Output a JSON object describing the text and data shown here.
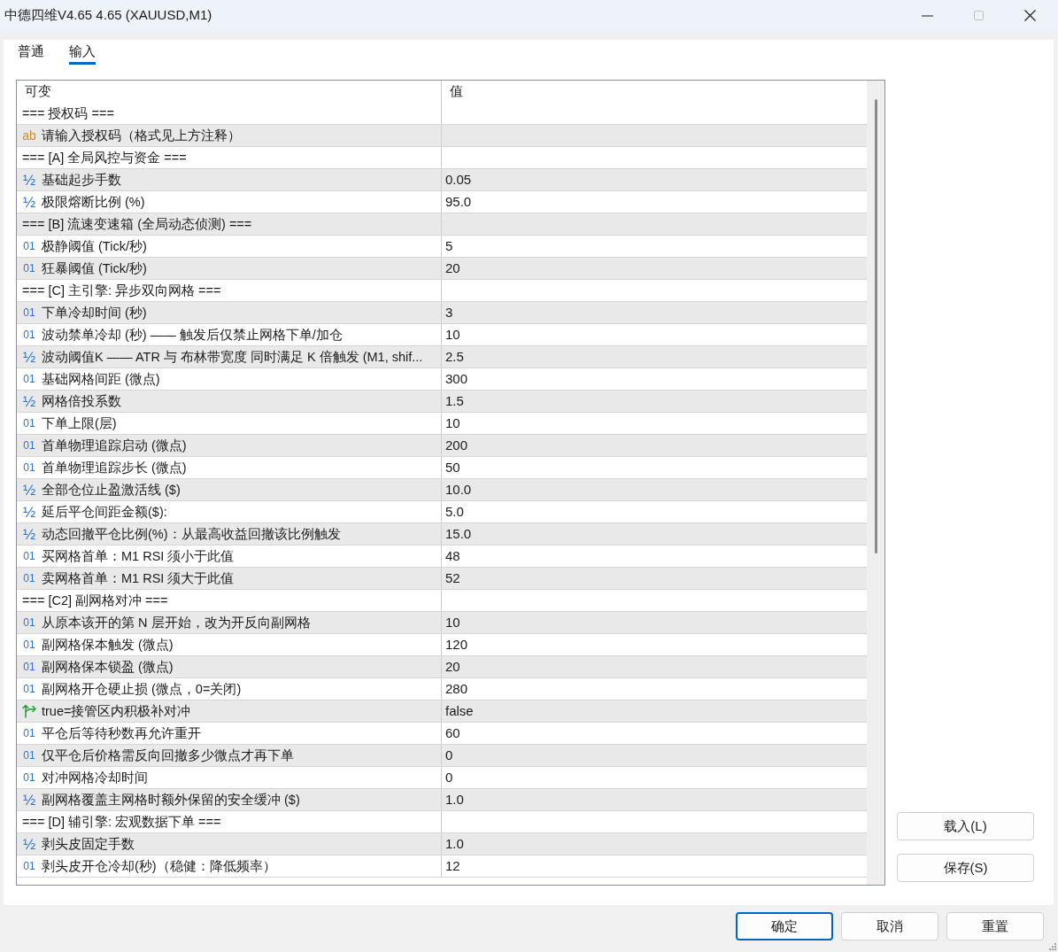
{
  "window": {
    "title": "中德四维V4.65 4.65 (XAUUSD,M1)",
    "controls": [
      {
        "kind": "minimize",
        "disabled": false
      },
      {
        "kind": "maximize",
        "disabled": true
      },
      {
        "kind": "close",
        "disabled": false
      }
    ]
  },
  "tabs": [
    {
      "label": "普通",
      "selected": false
    },
    {
      "label": "输入",
      "selected": true
    }
  ],
  "table": {
    "columns": [
      "可变",
      "值"
    ],
    "rows": [
      {
        "kind": "section",
        "name": "=== 授权码 ==="
      },
      {
        "kind": "string",
        "icon": "ab",
        "name": "请输入授权码（格式见上方注释）"
      },
      {
        "kind": "section",
        "name": "=== [A] 全局风控与资金 ==="
      },
      {
        "kind": "double",
        "icon": "½",
        "name": "基础起步手数",
        "value": "0.05"
      },
      {
        "kind": "double",
        "icon": "½",
        "name": "极限熔断比例 (%)",
        "value": "95.0"
      },
      {
        "kind": "section",
        "name": "=== [B] 流速变速箱 (全局动态侦测) ==="
      },
      {
        "kind": "int",
        "icon": "01",
        "name": "极静阈值 (Tick/秒)",
        "value": "5"
      },
      {
        "kind": "int",
        "icon": "01",
        "name": "狂暴阈值 (Tick/秒)",
        "value": "20"
      },
      {
        "kind": "section",
        "name": "=== [C] 主引擎: 异步双向网格 ==="
      },
      {
        "kind": "int",
        "icon": "01",
        "name": "下单冷却时间 (秒)",
        "value": "3"
      },
      {
        "kind": "int",
        "icon": "01",
        "name": "波动禁单冷却 (秒) —— 触发后仅禁止网格下单/加仓",
        "value": "10"
      },
      {
        "kind": "double",
        "icon": "½",
        "name": "波动阈值K —— ATR 与 布林带宽度 同时满足 K 倍触发 (M1, shif...",
        "value": "2.5"
      },
      {
        "kind": "int",
        "icon": "01",
        "name": "基础网格间距 (微点)",
        "value": "300"
      },
      {
        "kind": "double",
        "icon": "½",
        "name": "网格倍投系数",
        "value": "1.5"
      },
      {
        "kind": "int",
        "icon": "01",
        "name": "下单上限(层)",
        "value": "10"
      },
      {
        "kind": "int",
        "icon": "01",
        "name": "首单物理追踪启动 (微点)",
        "value": "200"
      },
      {
        "kind": "int",
        "icon": "01",
        "name": "首单物理追踪步长 (微点)",
        "value": "50"
      },
      {
        "kind": "double",
        "icon": "½",
        "name": "全部仓位止盈激活线 ($)",
        "value": "10.0"
      },
      {
        "kind": "double",
        "icon": "½",
        "name": "延后平仓间距金额($):",
        "value": "5.0"
      },
      {
        "kind": "double",
        "icon": "½",
        "name": "动态回撤平仓比例(%)：从最高收益回撤该比例触发",
        "value": "15.0"
      },
      {
        "kind": "int",
        "icon": "01",
        "name": "买网格首单：M1 RSI 须小于此值",
        "value": "48"
      },
      {
        "kind": "int",
        "icon": "01",
        "name": "卖网格首单：M1 RSI 须大于此值",
        "value": "52"
      },
      {
        "kind": "section",
        "name": "=== [C2] 副网格对冲 ==="
      },
      {
        "kind": "int",
        "icon": "01",
        "name": "从原本该开的第 N 层开始，改为开反向副网格",
        "value": "10"
      },
      {
        "kind": "int",
        "icon": "01",
        "name": "副网格保本触发 (微点)",
        "value": "120"
      },
      {
        "kind": "int",
        "icon": "01",
        "name": "副网格保本锁盈 (微点)",
        "value": "20"
      },
      {
        "kind": "int",
        "icon": "01",
        "name": "副网格开仓硬止损 (微点，0=关闭)",
        "value": "280"
      },
      {
        "kind": "bool",
        "name": "true=接管区内积极补对冲",
        "value": "false"
      },
      {
        "kind": "int",
        "icon": "01",
        "name": "平仓后等待秒数再允许重开",
        "value": "60"
      },
      {
        "kind": "int",
        "icon": "01",
        "name": "仅平仓后价格需反向回撤多少微点才再下单",
        "value": "0"
      },
      {
        "kind": "int",
        "icon": "01",
        "name": "对冲网格冷却时间",
        "value": "0"
      },
      {
        "kind": "double",
        "icon": "½",
        "name": "副网格覆盖主网格时额外保留的安全缓冲 ($)",
        "value": "1.0"
      },
      {
        "kind": "section",
        "name": "=== [D] 辅引擎: 宏观数据下单 ==="
      },
      {
        "kind": "double",
        "icon": "½",
        "name": "剥头皮固定手数",
        "value": "1.0"
      },
      {
        "kind": "int",
        "icon": "01",
        "name": "剥头皮开仓冷却(秒)（稳健：降低频率）",
        "value": "12"
      }
    ]
  },
  "side_buttons": [
    "载入(L)",
    "保存(S)"
  ],
  "footer_buttons": [
    {
      "label": "确定",
      "focused": true
    },
    {
      "label": "取消",
      "focused": false
    },
    {
      "label": "重置",
      "focused": false
    }
  ]
}
